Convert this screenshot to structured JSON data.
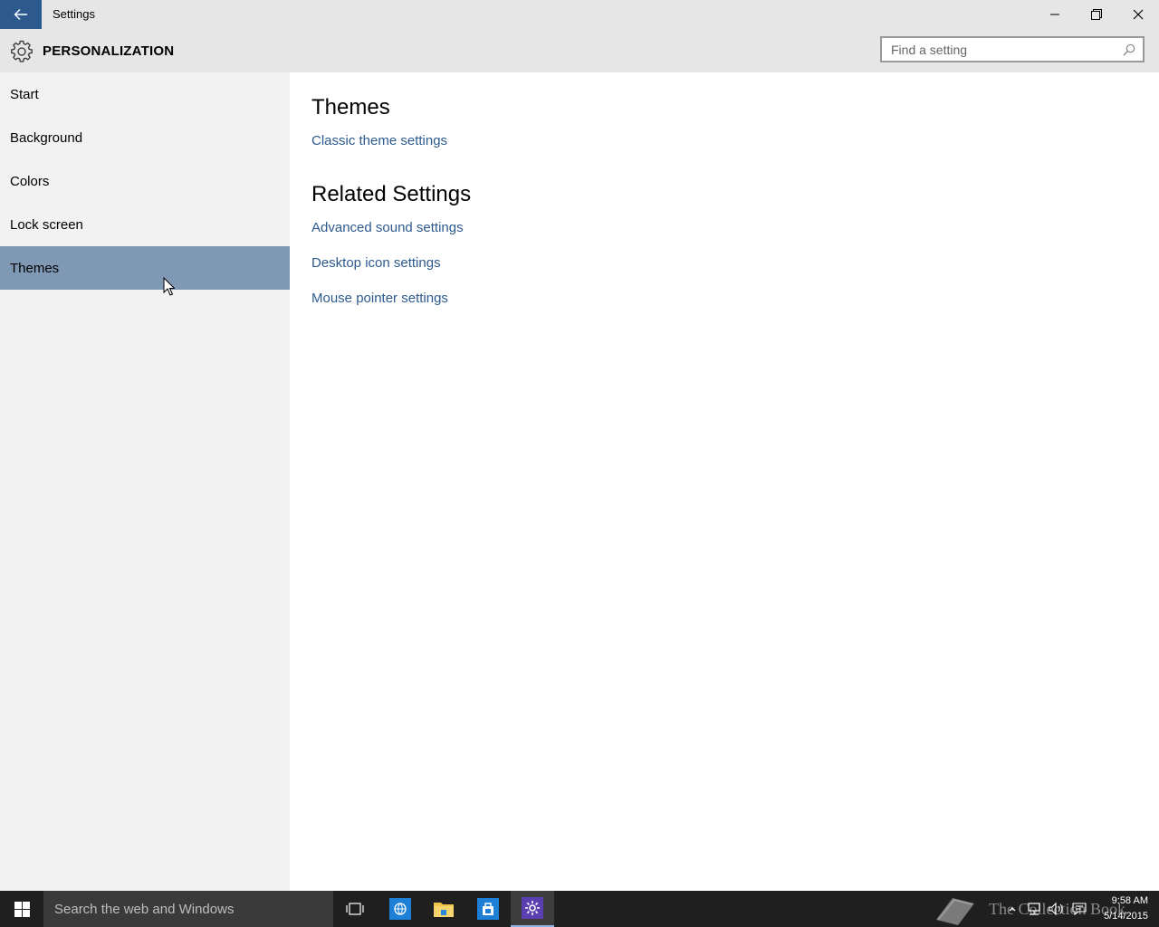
{
  "window": {
    "title": "Settings"
  },
  "header": {
    "title": "PERSONALIZATION",
    "search_placeholder": "Find a setting"
  },
  "sidebar": {
    "items": [
      {
        "label": "Start"
      },
      {
        "label": "Background"
      },
      {
        "label": "Colors"
      },
      {
        "label": "Lock screen"
      },
      {
        "label": "Themes"
      }
    ],
    "active": "Themes"
  },
  "main": {
    "themes_title": "Themes",
    "themes_links": [
      {
        "label": "Classic theme settings"
      }
    ],
    "related_title": "Related Settings",
    "related_links": [
      {
        "label": "Advanced sound settings"
      },
      {
        "label": "Desktop icon settings"
      },
      {
        "label": "Mouse pointer settings"
      }
    ]
  },
  "taskbar": {
    "search_placeholder": "Search the web and Windows",
    "apps": [
      "task-view-icon",
      "internet-explorer-icon",
      "file-explorer-icon",
      "store-icon",
      "settings-icon"
    ],
    "watermark": "The Collection Book",
    "time": "9:58 AM",
    "date": "5/14/2015"
  },
  "colors": {
    "accent": "#2d5a8e",
    "nav_active": "#7f98b4",
    "sidebar_bg": "#f2f2f2",
    "titlebar_bg": "#e6e6e6",
    "taskbar_bg": "#1f1f1f"
  }
}
